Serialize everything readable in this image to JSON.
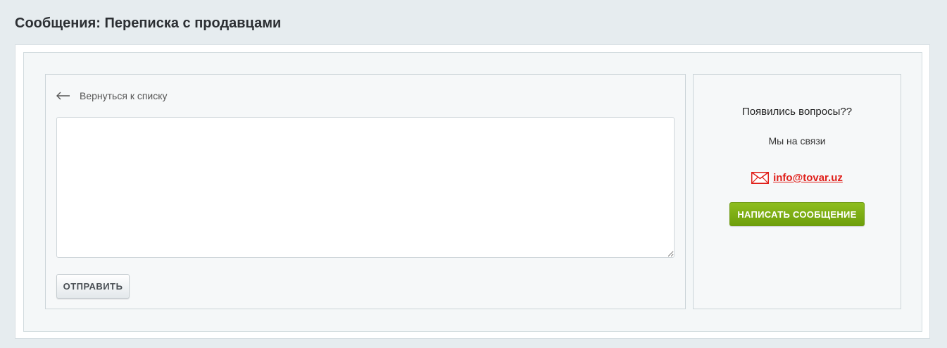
{
  "page": {
    "title": "Сообщения: Переписка с продавцами"
  },
  "chat": {
    "back_label": "Вернуться к списку",
    "message_value": "",
    "send_label": "ОТПРАВИТЬ"
  },
  "help": {
    "title": "Появились вопросы??",
    "subtitle": "Мы на связи",
    "email": "info@tovar.uz",
    "write_label": "НАПИСАТЬ СООБЩЕНИЕ"
  },
  "icons": {
    "back": "arrow-left-icon",
    "mail": "envelope-icon"
  },
  "colors": {
    "background": "#e6ecef",
    "accent_green": "#7aad14",
    "email_red": "#e0201b"
  }
}
